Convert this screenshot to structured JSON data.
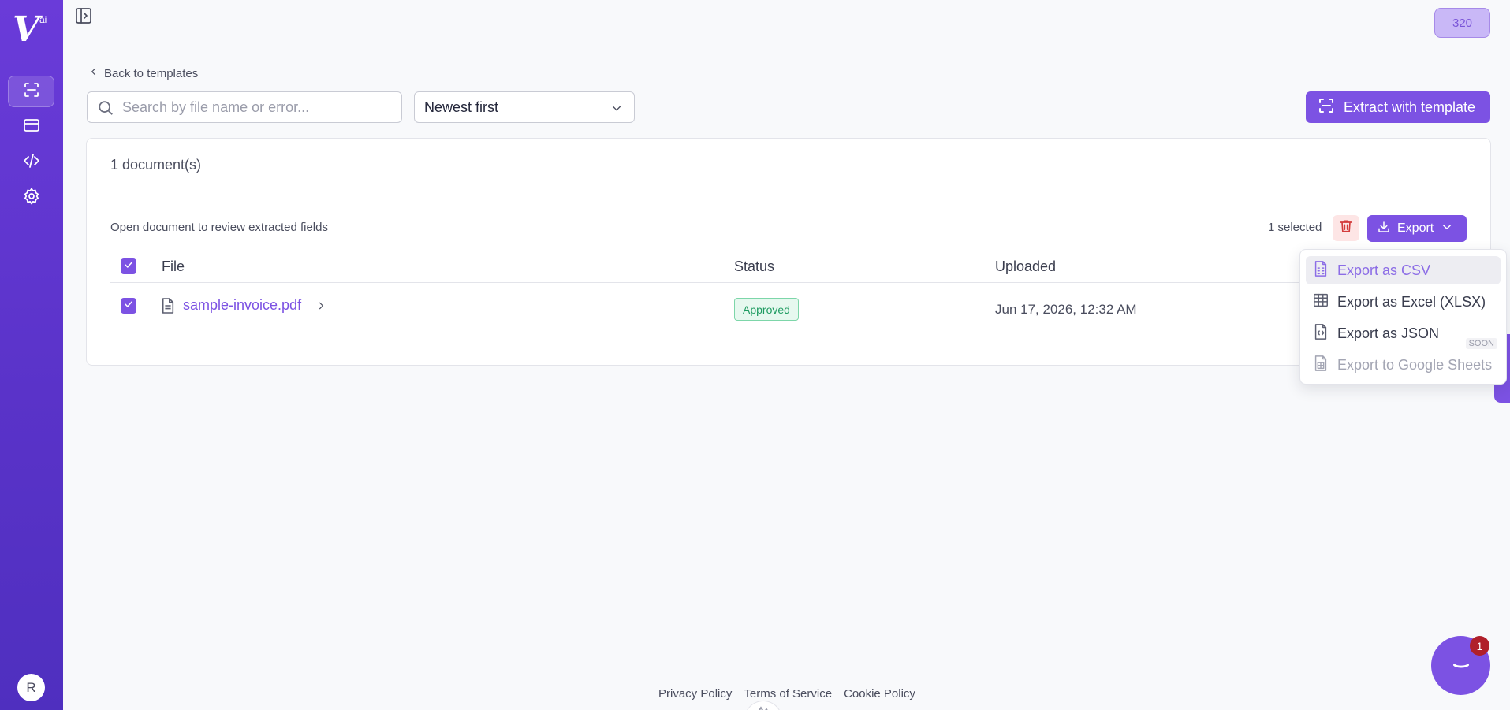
{
  "brand": {
    "logo_letter": "V",
    "logo_suffix": "ai",
    "accent": "#7c52e3",
    "sidebar_color": "#5a33c9"
  },
  "sidebar": {
    "items": [
      {
        "name": "extract",
        "icon": "scan-icon",
        "active": true
      },
      {
        "name": "billing",
        "icon": "credit-card-icon",
        "active": false
      },
      {
        "name": "api",
        "icon": "code-icon",
        "active": false
      },
      {
        "name": "settings",
        "icon": "gear-icon",
        "active": false
      }
    ],
    "avatar_initial": "R"
  },
  "topbar": {
    "credits": "320"
  },
  "nav": {
    "back_label": "Back to templates"
  },
  "search": {
    "placeholder": "Search by file name or error..."
  },
  "sort": {
    "selected": "Newest first"
  },
  "actions": {
    "extract_label": "Extract with template"
  },
  "documents": {
    "count_label": "1 document(s)",
    "hint": "Open document to review extracted fields",
    "selected_label": "1 selected",
    "export_label": "Export",
    "columns": [
      "File",
      "Status",
      "Uploaded"
    ],
    "rows": [
      {
        "file": "sample-invoice.pdf",
        "status": "Approved",
        "uploaded": "Jun 17, 2026, 12:32 AM",
        "checked": true
      }
    ]
  },
  "export_menu": {
    "items": [
      {
        "label": "Export as CSV",
        "icon": "file-csv-icon",
        "state": "highlighted"
      },
      {
        "label": "Export as Excel (XLSX)",
        "icon": "table-icon",
        "state": "normal"
      },
      {
        "label": "Export as JSON",
        "icon": "file-json-icon",
        "state": "normal"
      },
      {
        "label": "Export to Google Sheets",
        "icon": "sheets-icon",
        "state": "disabled",
        "badge": "SOON"
      }
    ]
  },
  "chat": {
    "unread": "1"
  },
  "footer": {
    "links": [
      "Privacy Policy",
      "Terms of Service",
      "Cookie Policy"
    ]
  }
}
